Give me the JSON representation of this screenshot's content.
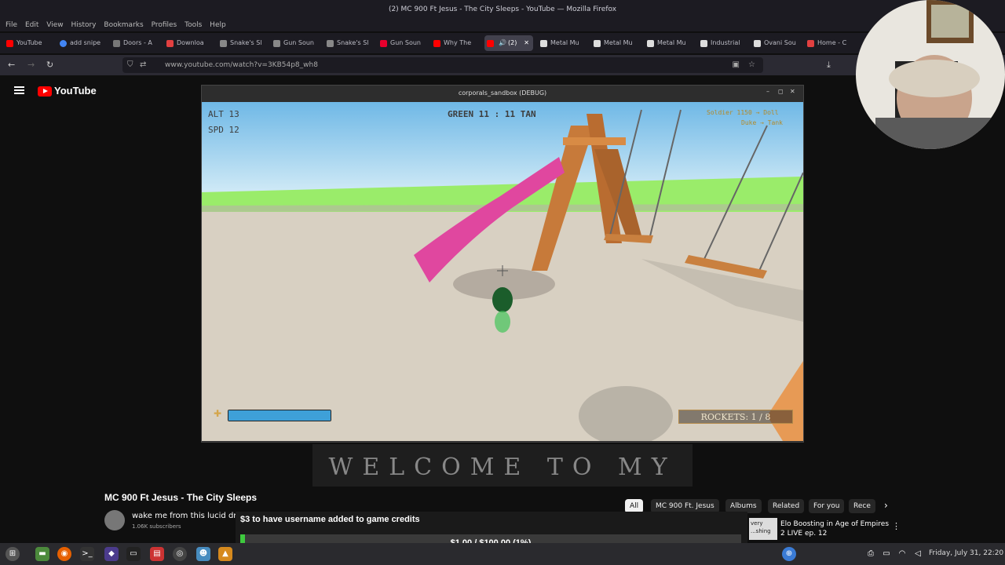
{
  "window": {
    "title": "(2) MC 900 Ft Jesus - The City Sleeps - YouTube — Mozilla Firefox"
  },
  "menu": [
    "File",
    "Edit",
    "View",
    "History",
    "Bookmarks",
    "Profiles",
    "Tools",
    "Help"
  ],
  "tabs": [
    {
      "label": "YouTube",
      "color": "#ff0000"
    },
    {
      "label": "add snipe",
      "color": "#4285f4"
    },
    {
      "label": "Doors - A",
      "color": "#777777"
    },
    {
      "label": "Downloa",
      "color": "#e24040"
    },
    {
      "label": "Snake's Sl",
      "color": "#888888"
    },
    {
      "label": "Gun Soun",
      "color": "#888888"
    },
    {
      "label": "Snake's Sl",
      "color": "#888888"
    },
    {
      "label": "Gun Soun",
      "color": "#e8002d"
    },
    {
      "label": "Why The",
      "color": "#ff0000"
    },
    {
      "label": "(2)",
      "color": "#ff0000"
    },
    {
      "label": "Metal Mu",
      "color": "#dddddd"
    },
    {
      "label": "Metal Mu",
      "color": "#dddddd"
    },
    {
      "label": "Metal Mu",
      "color": "#dddddd"
    },
    {
      "label": "Industrial",
      "color": "#dddddd"
    },
    {
      "label": "Ovani Sou",
      "color": "#dddddd"
    },
    {
      "label": "Home - C",
      "color": "#e24040"
    }
  ],
  "url": "www.youtube.com/watch?v=3KB54p8_wh8",
  "youtube": {
    "logo": "YouTube",
    "video_title": "MC 900 Ft Jesus - The City Sleeps",
    "channel_name": "wake me from this lucid dr",
    "subscribers": "1.06K subscribers",
    "chips": [
      "All",
      "MC 900 Ft. Jesus",
      "Albums",
      "Related",
      "For you",
      "Rece"
    ],
    "related_title": "Elo Boosting in Age of Empires 2 LIVE ep. 12",
    "related_thumb_text": "very ...shing"
  },
  "banner": "WELCOME TO MY DREAM",
  "game": {
    "window_title": "corporals_sandbox (DEBUG)",
    "alt_label": "ALT 13",
    "spd_label": "SPD 12",
    "score": "GREEN 11  :  11 TAN",
    "killfeed_1": "Soldier 1150 → Doll",
    "killfeed_2": "Duke → Tank",
    "rockets": "ROCKETS: 1 / 8",
    "health_fraction": 1.0
  },
  "donation": {
    "text": "$3 to have username added to game credits",
    "amount": "$1.00 / $100.00 (1%)",
    "progress": 0.01
  },
  "taskbar": {
    "clock": "Friday, July 31, 22:20"
  }
}
